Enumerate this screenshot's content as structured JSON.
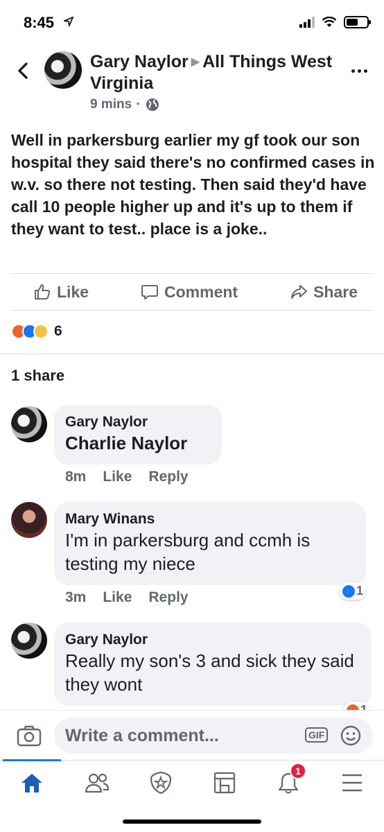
{
  "status_bar": {
    "time": "8:45"
  },
  "post": {
    "author": "Gary Naylor",
    "group": "All Things West Virginia",
    "time": "9 mins",
    "text": "Well in parkersburg earlier my gf took our son hospital they said there's no confirmed cases in w.v. so there not testing. Then said they'd have call 10 people higher up and it's up to them if they want to test.. place is a joke..",
    "reaction_count": "6",
    "shares": "1 share"
  },
  "actions": {
    "like": "Like",
    "comment": "Comment",
    "share": "Share"
  },
  "comments": [
    {
      "name": "Gary Naylor",
      "text": "Charlie Naylor",
      "time": "8m",
      "like": "Like",
      "reply": "Reply"
    },
    {
      "name": "Mary Winans",
      "text": "I'm in parkersburg and ccmh is testing my niece",
      "time": "3m",
      "like": "Like",
      "reply": "Reply",
      "reactions": "1"
    },
    {
      "name": "Gary Naylor",
      "text": "Really my son's 3 and sick they said they wont",
      "reactions": "1"
    }
  ],
  "composer": {
    "placeholder": "Write a comment...",
    "gif": "GIF"
  },
  "tabbar": {
    "notifications_badge": "1"
  },
  "colors": {
    "accent": "#1877f2",
    "badge": "#e41e3f",
    "bubble": "#f0f2f5"
  }
}
